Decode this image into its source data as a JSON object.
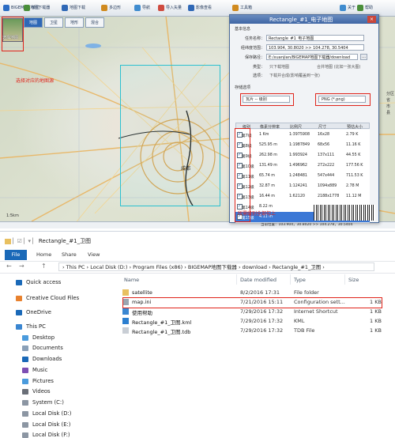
{
  "map_app": {
    "title": "BIGEMAP地图下载器",
    "toolbar": [
      {
        "label": "BIGEMAP 地图下载器",
        "color": "#2b6cc4"
      },
      {
        "label": "单位",
        "color": "#4a8f3a"
      },
      {
        "label": "地图下载",
        "color": "#2f68b6"
      },
      {
        "label": "多边形",
        "color": "#d08a1e"
      },
      {
        "label": "导航",
        "color": "#3f8ccf"
      },
      {
        "label": "导入矢量",
        "color": "#cf4b3f"
      },
      {
        "label": "影像查看",
        "color": "#2f68b6"
      },
      {
        "label": "工具箱",
        "color": "#d08a1e"
      },
      {
        "label": "关于",
        "color": "#3f8ccf"
      },
      {
        "label": "帮助",
        "color": "#4a8f3a"
      }
    ],
    "map_tabs": [
      {
        "label": "地图",
        "active": true
      },
      {
        "label": "卫星",
        "active": false
      },
      {
        "label": "地形",
        "active": false
      },
      {
        "label": "混合",
        "active": false
      }
    ],
    "thumb_label": "选择地图",
    "map_note": "选择对应的地图源",
    "city_label": "成都",
    "side_labels": [
      "分区",
      "省",
      "市",
      "县"
    ],
    "status_text": "当前位置：103.904，30.8020 >> 104.278，30.5404",
    "scale_text": "1:5km",
    "dialog": {
      "title": "Rectangle_#1_电子地图",
      "close": "×",
      "basic_group": "基本信息",
      "fields": [
        {
          "label": "任务名称：",
          "value": "Rectangle_#1_电子地图"
        },
        {
          "label": "经纬度范围：",
          "value": "103.904, 30.8020   >>   104.278, 30.5404"
        },
        {
          "label": "保存路径：",
          "value": "E:/xuanjian/BIGEMAP地图下载器/download"
        }
      ],
      "opt1_label": "类型：",
      "opt1": "只下载地图",
      "opt1b": "合并地图 (比如一张大图)",
      "opt2_label": "选项：",
      "opt2": "下载并合成(影响覆盖到一张)",
      "store_group": "存储选项",
      "tile_select": "瓦片 -- 级别",
      "format_select": "PNG (*.png)",
      "table_headers": [
        "级别",
        "像素分辨率",
        "比例尺",
        "尺寸",
        "预估大小"
      ],
      "levels": [
        {
          "level": "第7级",
          "res": "1 Km",
          "scale": "1:3975908",
          "size": "16x28",
          "est": "2.79 K"
        },
        {
          "level": "第8级",
          "res": "525.95 m",
          "scale": "1:1987849",
          "size": "68x56",
          "est": "11.16 K"
        },
        {
          "level": "第9级",
          "res": "262.98 m",
          "scale": "1:993924",
          "size": "137x111",
          "est": "44.55 K"
        },
        {
          "level": "第10级",
          "res": "131.49 m",
          "scale": "1:496962",
          "size": "272x222",
          "est": "177.56 K"
        },
        {
          "level": "第11级",
          "res": "65.74 m",
          "scale": "1:248481",
          "size": "547x444",
          "est": "711.53 K"
        },
        {
          "level": "第12级",
          "res": "32.87 m",
          "scale": "1:124241",
          "size": "1094x889",
          "est": "2.78 M"
        },
        {
          "level": "第13级",
          "res": "16.44 m",
          "scale": "1:62120",
          "size": "2188x1778",
          "est": "11.12 M"
        },
        {
          "level": "第14级",
          "res": "8.22 m",
          "scale": "",
          "size": "",
          "est": ""
        },
        {
          "level": "第15级",
          "res": "4.11 m",
          "scale": "",
          "size": "",
          "est": ""
        }
      ],
      "note": "所需级别全部勾上"
    }
  },
  "explorer": {
    "window_title": "Rectangle_#1_卫图",
    "tabs": [
      "File",
      "Home",
      "Share",
      "View"
    ],
    "nav": [
      "←",
      "→",
      "↑"
    ],
    "address": "›  This PC  ›  Local Disk (D:)  ›  Program Files (x86)  ›  BIGEMAP地图下载器  ›  download  ›  Rectangle_#1_卫图  ›",
    "nav_items": [
      {
        "label": "Quick access",
        "icon": "star-icon",
        "color": "#1a69b8"
      },
      {
        "label": "Creative Cloud Files",
        "icon": "cloud-folder-icon",
        "color": "#e8812e"
      },
      {
        "label": "OneDrive",
        "icon": "onedrive-icon",
        "color": "#1a69b8"
      },
      {
        "label": "This PC",
        "icon": "computer-icon",
        "color": "#3a86d1"
      },
      {
        "label": "Desktop",
        "icon": "desktop-icon",
        "color": "#4a9bdd"
      },
      {
        "label": "Documents",
        "icon": "documents-icon",
        "color": "#8aa0b8"
      },
      {
        "label": "Downloads",
        "icon": "downloads-icon",
        "color": "#1a69b8"
      },
      {
        "label": "Music",
        "icon": "music-icon",
        "color": "#7d4fb4"
      },
      {
        "label": "Pictures",
        "icon": "pictures-icon",
        "color": "#4a9bdd"
      },
      {
        "label": "Videos",
        "icon": "videos-icon",
        "color": "#6a6f78"
      },
      {
        "label": "System (C:)",
        "icon": "drive-icon",
        "color": "#8c96a3"
      },
      {
        "label": "Local Disk (D:)",
        "icon": "drive-icon",
        "color": "#8c96a3"
      },
      {
        "label": "Local Disk (E:)",
        "icon": "drive-icon",
        "color": "#8c96a3"
      },
      {
        "label": "Local Disk (F:)",
        "icon": "drive-icon",
        "color": "#8c96a3"
      }
    ],
    "columns": [
      "Name",
      "Date modified",
      "Type",
      "Size"
    ],
    "files": [
      {
        "name": "satellite",
        "date": "8/2/2016 17:31",
        "type": "File folder",
        "size": "",
        "icon": "folder-icon",
        "color": "#e8c060"
      },
      {
        "name": "map.ini",
        "date": "7/21/2016 15:11",
        "type": "Configuration sett...",
        "size": "1 KB",
        "icon": "ini-file-icon",
        "color": "#9aa5b1"
      },
      {
        "name": "使用帮助",
        "date": "7/29/2016 17:32",
        "type": "Internet Shortcut",
        "size": "1 KB",
        "icon": "shortcut-icon",
        "color": "#3a86d1"
      },
      {
        "name": "Rectangle_#1_卫图.kml",
        "date": "7/29/2016 17:32",
        "type": "KML",
        "size": "1 KB",
        "icon": "kml-file-icon",
        "color": "#2c7fd0"
      },
      {
        "name": "Rectangle_#1_卫图.tdb",
        "date": "7/29/2016 17:32",
        "type": "TDB File",
        "size": "1 KB",
        "icon": "file-icon",
        "color": "#c9ced5"
      }
    ],
    "highlight_color": "#e0241b"
  }
}
